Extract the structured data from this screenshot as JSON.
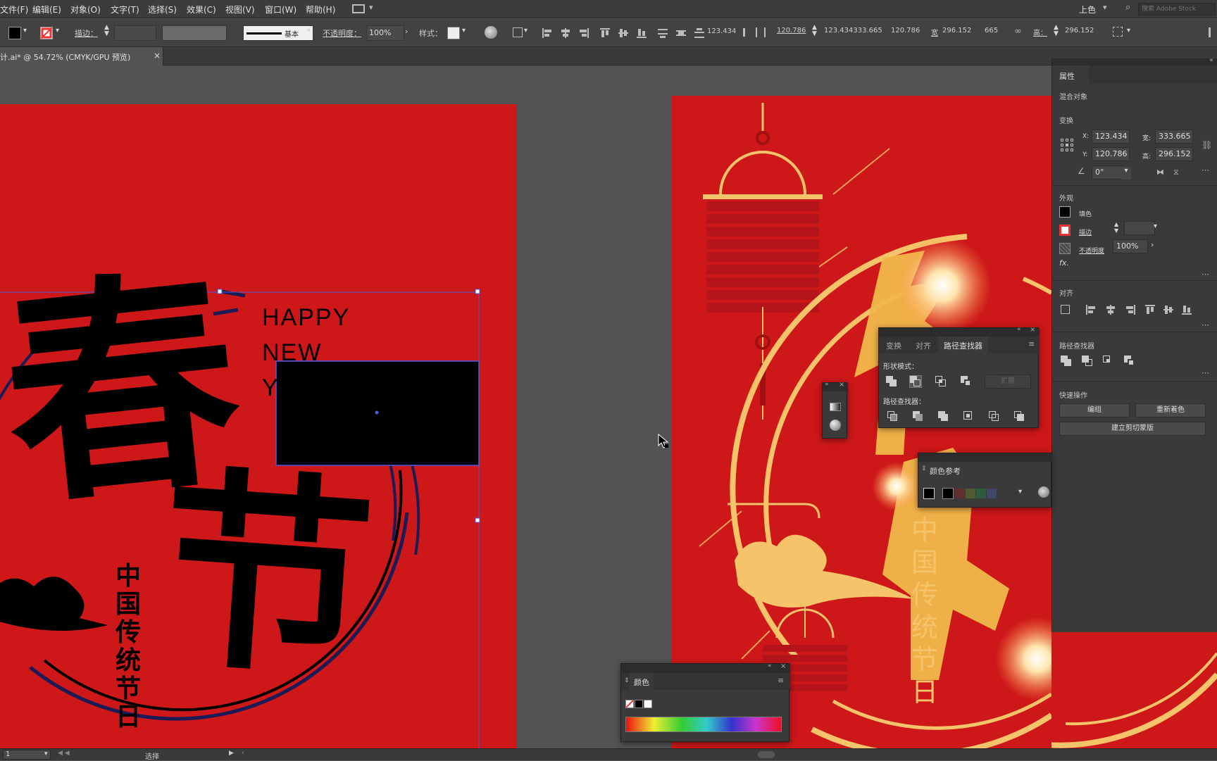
{
  "menu": [
    "文件(F)",
    "编辑(E)",
    "对象(O)",
    "文字(T)",
    "选择(S)",
    "效果(C)",
    "视图(V)",
    "窗口(W)",
    "帮助(H)"
  ],
  "workspace": "上色",
  "stock_search_placeholder": "搜索 Adobe Stock",
  "control": {
    "stroke_label": "描边：",
    "brush_style": "基本",
    "opacity_label": "不透明度：",
    "opacity_value": "100%",
    "style_label": "样式：",
    "x_val": "123.434",
    "y_val": "120.786",
    "xy_pair": "123.434333.665",
    "w_short": "120.786",
    "w_label": "宽",
    "w_val": "296.152",
    "w_val2": "665",
    "h_label": "高：",
    "h_val": "296.152"
  },
  "document_tab": {
    "title": "计.ai* @ 54.72% (CMYK/GPU 预览)"
  },
  "artwork_left": {
    "greeting_lines": [
      "HAPPY",
      "NEW",
      "Y"
    ],
    "big_chars": [
      "春",
      "节"
    ],
    "vertical_text": [
      "中",
      "国",
      "传",
      "统",
      "节",
      "日"
    ]
  },
  "artwork_right": {
    "vertical_text": [
      "中",
      "国",
      "传",
      "统",
      "节",
      "日"
    ]
  },
  "properties": {
    "tab": "属性",
    "object_type": "混合对象",
    "transform_label": "变换",
    "x_label": "X:",
    "x": "123.434",
    "y_label": "Y:",
    "y": "120.786",
    "w_label": "宽:",
    "w": "333.665",
    "h_label": "高:",
    "h": "296.152",
    "angle": "0°",
    "appearance_label": "外观",
    "fill_label": "填色",
    "stroke_label": "描边",
    "opacity_label": "不透明度",
    "opacity": "100%",
    "fx": "fx.",
    "align_label": "对齐",
    "pathfinder_label": "路径查找器",
    "quick_actions_label": "快速操作",
    "btn_group": "编组",
    "btn_recolor": "重新着色",
    "btn_clip": "建立剪切蒙版"
  },
  "pathfinder_panel": {
    "tabs": [
      "变换",
      "对齐",
      "路径查找器"
    ],
    "shape_modes_label": "形状模式：",
    "expand_label": "扩展",
    "pathfinders_label": "路径查找器："
  },
  "color_guide": {
    "title": "颜色参考"
  },
  "color_panel": {
    "title": "颜色"
  },
  "status": {
    "zoom": "1",
    "tool": "选择"
  },
  "colors": {
    "art_red": "#cd1719",
    "gold": "#f5c46a",
    "ui_dark": "#3a3a3a"
  }
}
